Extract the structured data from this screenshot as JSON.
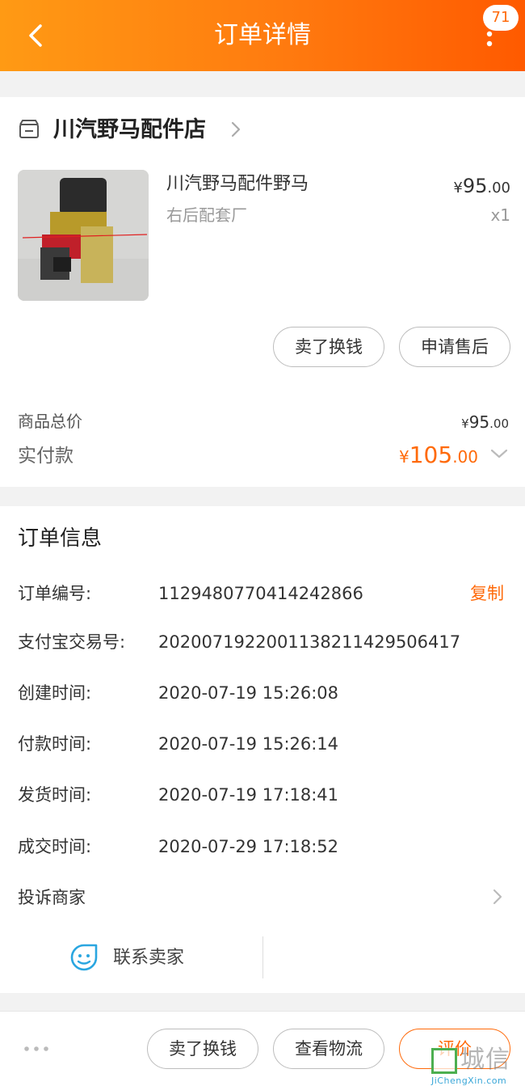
{
  "header": {
    "title": "订单详情",
    "badge": "71"
  },
  "shop": {
    "name": "川汽野马配件店"
  },
  "item": {
    "name": "川汽野马配件野马",
    "spec": "右后配套厂",
    "price_currency": "¥",
    "price_int": "95",
    "price_dec": ".00",
    "qty": "x1",
    "actions": [
      "卖了换钱",
      "申请售后"
    ]
  },
  "totals": {
    "goods_label": "商品总价",
    "goods_currency": "¥",
    "goods_int": "95",
    "goods_dec": ".00",
    "paid_label": "实付款",
    "paid_currency": "¥",
    "paid_int": "105",
    "paid_dec": ".00"
  },
  "order_info": {
    "title": "订单信息",
    "copy_label": "复制",
    "rows": [
      {
        "label": "订单编号:",
        "value": "1129480770414242866"
      },
      {
        "label": "支付宝交易号:",
        "value": "2020071922001138211429506417"
      },
      {
        "label": "创建时间:",
        "value": "2020-07-19 15:26:08"
      },
      {
        "label": "付款时间:",
        "value": "2020-07-19 15:26:14"
      },
      {
        "label": "发货时间:",
        "value": "2020-07-19 17:18:41"
      },
      {
        "label": "成交时间:",
        "value": "2020-07-29 17:18:52"
      }
    ],
    "complain_label": "投诉商家",
    "contact_label": "联系卖家"
  },
  "bottom": {
    "buttons": [
      "卖了换钱",
      "查看物流",
      "评价"
    ]
  },
  "watermark": {
    "text": "城信",
    "sub": "JiChengXin.com"
  },
  "colors": {
    "accent": "#ff6a0a",
    "header_start": "#ff9a14",
    "header_end": "#ff5a00"
  }
}
